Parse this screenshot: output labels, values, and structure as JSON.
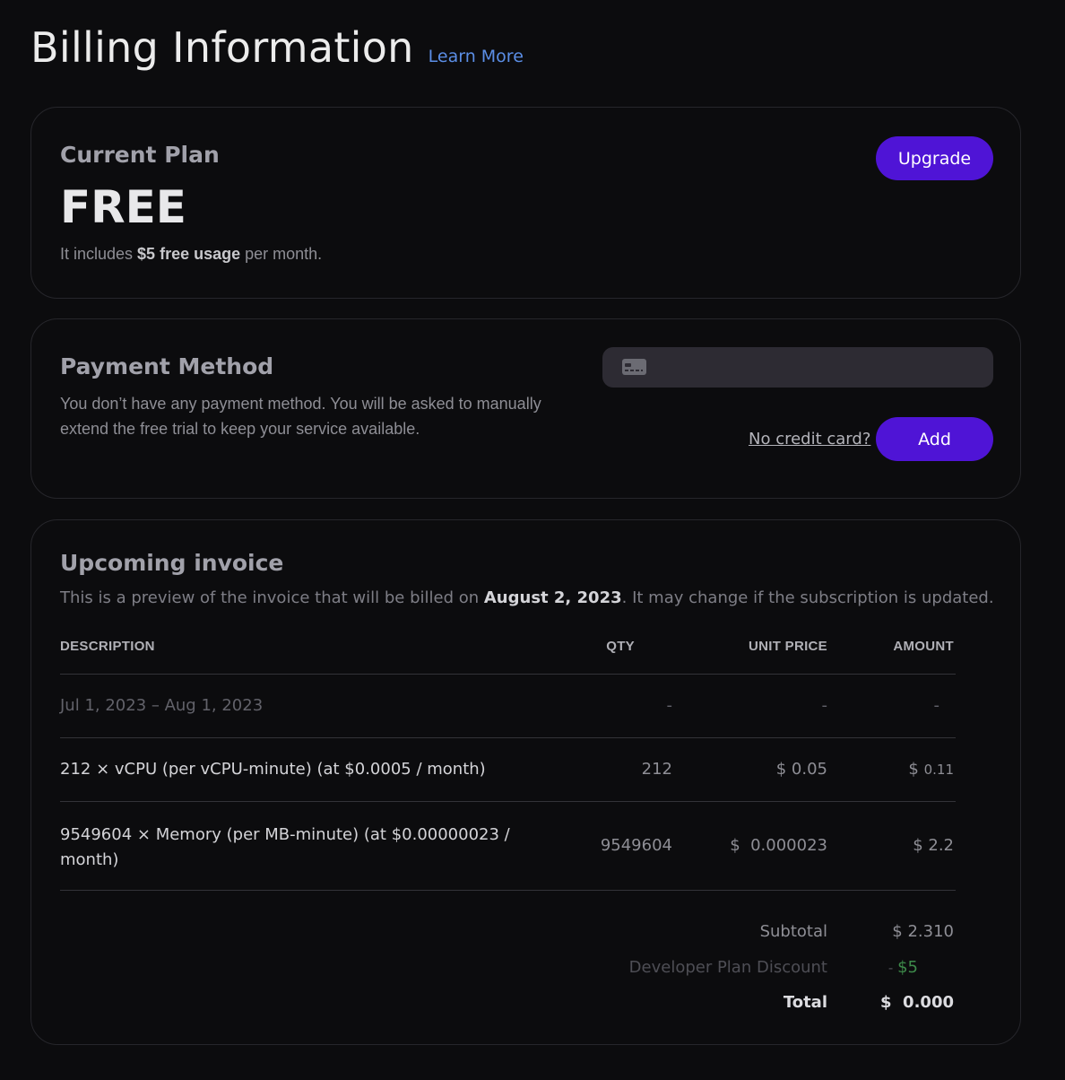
{
  "header": {
    "title": "Billing Information",
    "learn_more": "Learn More"
  },
  "plan": {
    "heading": "Current Plan",
    "name": "FREE",
    "desc_prefix": "It includes ",
    "desc_bold": "$5 free usage",
    "desc_suffix": " per month.",
    "upgrade_label": "Upgrade"
  },
  "payment": {
    "heading": "Payment Method",
    "description": "You don’t have any payment method. You will be asked to manually extend the free trial to keep your service available.",
    "card_icon": "credit-card-icon",
    "no_card_link": "No credit card?",
    "add_label": "Add"
  },
  "invoice": {
    "heading": "Upcoming invoice",
    "desc_prefix": "This is a preview of the invoice that will be billed on ",
    "desc_date": "August 2, 2023",
    "desc_suffix": ". It may change if the subscription is updated.",
    "columns": {
      "description": "DESCRIPTION",
      "qty": "QTY",
      "unit_price": "UNIT PRICE",
      "amount": "AMOUNT"
    },
    "rows": [
      {
        "description": "Jul 1, 2023 – Aug 1, 2023",
        "qty": "-",
        "unit_price": "-",
        "amount": "-"
      },
      {
        "description": "212 × vCPU (per vCPU-minute) (at $0.0005 / month)",
        "qty": "212",
        "unit_price": "$ 0.05",
        "amount_symbol": "$ ",
        "amount_value": "0.11"
      },
      {
        "description_line1": "9549604 × Memory (per MB-minute) (at $0.00000023 /",
        "description_line2": "month)",
        "qty": "9549604",
        "unit_price": "$  0.000023",
        "amount": "$ 2.2"
      }
    ],
    "totals": {
      "subtotal_label": "Subtotal",
      "subtotal_value": "$ 2.310",
      "discount_label": "Developer Plan Discount",
      "discount_prefix": "- ",
      "discount_value": "$5",
      "total_label": "Total",
      "total_value": "$  0.000"
    }
  },
  "colors": {
    "accent": "#4f14d6",
    "link": "#5b8ee6",
    "discount": "#3d8a4a",
    "background": "#0c0c0e"
  }
}
